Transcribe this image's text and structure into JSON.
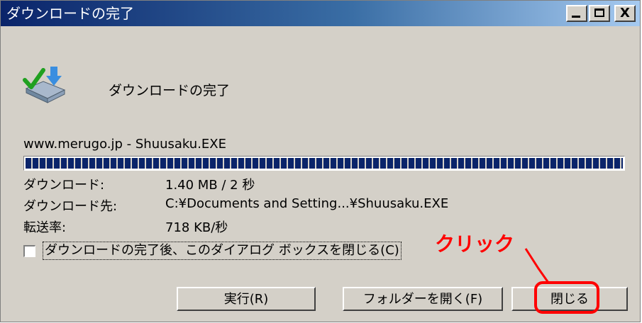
{
  "window": {
    "title": "ダウンロードの完了",
    "close_glyph": "X"
  },
  "dialog": {
    "heading": "ダウンロードの完了",
    "source": "www.merugo.jp - Shuusaku.EXE",
    "progress": 1.0,
    "info": [
      {
        "label": "ダウンロード:",
        "value": "1.40 MB / 2 秒"
      },
      {
        "label": "ダウンロード先:",
        "value": "C:¥Documents and Setting...¥Shuusaku.EXE"
      },
      {
        "label": "転送率:",
        "value": "718 KB/秒"
      }
    ],
    "checkbox": {
      "label": "ダウンロードの完了後、このダイアログ ボックスを閉じる(C)",
      "checked": false
    },
    "buttons": {
      "run": "実行(R)",
      "open_folder": "フォルダーを開く(F)",
      "close": "閉じる"
    }
  },
  "annotation": {
    "callout": "クリック",
    "color": "#ff0000"
  },
  "colors": {
    "titlebar_start": "#0a246a",
    "titlebar_end": "#a6caf0",
    "face": "#d4d0c8",
    "progress": "#0a246a"
  },
  "icons": {
    "dialog": "download-complete-icon"
  }
}
